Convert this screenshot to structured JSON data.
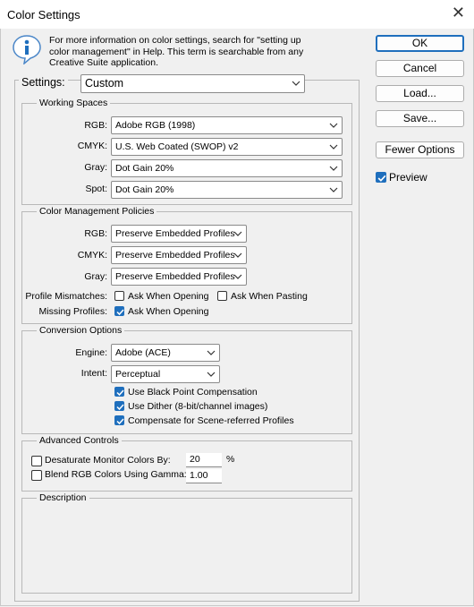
{
  "window": {
    "title": "Color Settings",
    "close_glyph": "✕"
  },
  "info": {
    "icon": "info-icon",
    "text_line1": "For more information on color settings, search for \"setting up",
    "text_line2": "color management\" in Help. This term is searchable from any",
    "text_line3": "Creative Suite application."
  },
  "settings": {
    "label": "Settings:",
    "value": "Custom"
  },
  "working_spaces": {
    "title": "Working Spaces",
    "rows": [
      {
        "label": "RGB:",
        "value": "Adobe RGB (1998)"
      },
      {
        "label": "CMYK:",
        "value": "U.S. Web Coated (SWOP) v2"
      },
      {
        "label": "Gray:",
        "value": "Dot Gain 20%"
      },
      {
        "label": "Spot:",
        "value": "Dot Gain 20%"
      }
    ]
  },
  "policies": {
    "title": "Color Management Policies",
    "rows": [
      {
        "label": "RGB:",
        "value": "Preserve Embedded Profiles"
      },
      {
        "label": "CMYK:",
        "value": "Preserve Embedded Profiles"
      },
      {
        "label": "Gray:",
        "value": "Preserve Embedded Profiles"
      }
    ],
    "mismatch_label": "Profile Mismatches:",
    "ask_opening": "Ask When Opening",
    "ask_pasting": "Ask When Pasting",
    "mismatch_ask_opening_checked": false,
    "mismatch_ask_pasting_checked": false,
    "missing_label": "Missing Profiles:",
    "missing_ask_opening": "Ask When Opening",
    "missing_ask_opening_checked": true
  },
  "conversion": {
    "title": "Conversion Options",
    "engine_label": "Engine:",
    "engine_value": "Adobe (ACE)",
    "intent_label": "Intent:",
    "intent_value": "Perceptual",
    "black_point": "Use Black Point Compensation",
    "black_point_checked": true,
    "dither": "Use Dither (8-bit/channel images)",
    "dither_checked": true,
    "scene": "Compensate for Scene-referred Profiles",
    "scene_checked": true
  },
  "advanced": {
    "title": "Advanced Controls",
    "desaturate": "Desaturate Monitor Colors By:",
    "desaturate_checked": false,
    "desaturate_value": "20",
    "desaturate_unit": "%",
    "blend": "Blend RGB Colors Using Gamma:",
    "blend_checked": false,
    "blend_value": "1.00"
  },
  "description": {
    "title": "Description"
  },
  "buttons": {
    "ok": "OK",
    "cancel": "Cancel",
    "load": "Load...",
    "save": "Save...",
    "fewer": "Fewer Options"
  },
  "preview": {
    "label": "Preview",
    "checked": true
  },
  "colors": {
    "accent": "#1f6fbd",
    "background": "#f0f0f0"
  }
}
